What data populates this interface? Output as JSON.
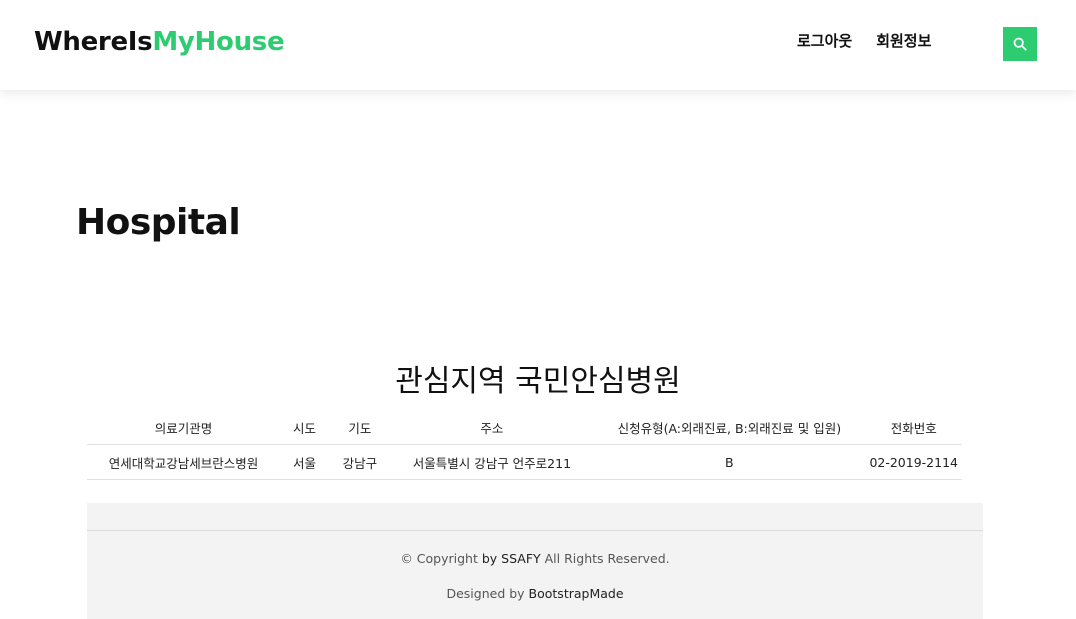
{
  "header": {
    "logo_part1": "WhereIs",
    "logo_part2": "MyHouse",
    "nav": [
      {
        "label": "로그아웃"
      },
      {
        "label": "회원정보"
      }
    ],
    "search_icon": "search-icon",
    "accent_color": "#2ecc71"
  },
  "main": {
    "page_title": "Hospital",
    "section_title": "관심지역 국민안심병원",
    "table": {
      "columns": [
        "의료기관명",
        "시도",
        "기도",
        "주소",
        "신청유형(A:외래진료, B:외래진료 및 입원)",
        "전화번호"
      ],
      "rows": [
        [
          "연세대학교강남세브란스병원",
          "서울",
          "강남구",
          "서울특별시 강남구 언주로211",
          "B",
          "02-2019-2114"
        ]
      ]
    }
  },
  "footer": {
    "copyright_prefix": "© Copyright ",
    "copyright_owner": "by SSAFY",
    "copyright_suffix": " All Rights Reserved.",
    "credits_prefix": "Designed by ",
    "credits_link": "BootstrapMade"
  }
}
